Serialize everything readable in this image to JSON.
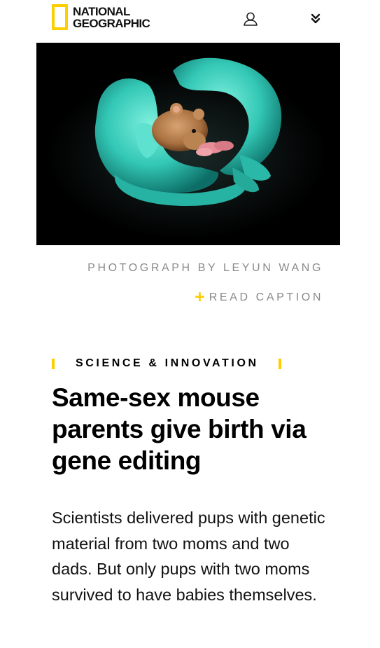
{
  "header": {
    "logo_line1": "NATIONAL",
    "logo_line2": "GEOGRAPHIC",
    "user_icon": "user-icon",
    "menu_icon": "double-chevron-down-icon",
    "brand_color": "#FFCE00"
  },
  "hero": {
    "image_description_icon": "hero-photo"
  },
  "photo_credit": "PHOTOGRAPH BY LEYUN WANG",
  "read_caption": {
    "icon": "plus-icon",
    "label": "READ CAPTION"
  },
  "article": {
    "section": "SCIENCE & INNOVATION",
    "headline": "Same-sex mouse parents give birth via gene editing",
    "dek": "Scientists delivered pups with genetic material from two moms and two dads. But only pups with two moms survived to have babies themselves."
  }
}
